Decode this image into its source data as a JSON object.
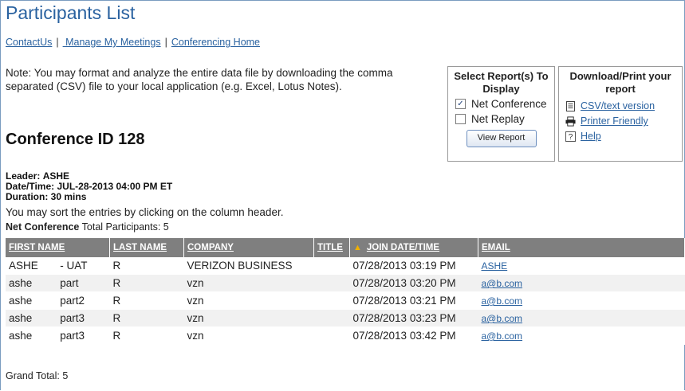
{
  "page": {
    "title": "Participants List"
  },
  "nav": {
    "contact": "ContactUs",
    "meetings": " Manage My Meetings",
    "home": "Conferencing Home",
    "separator": "|"
  },
  "note": "Note: You may format and analyze the entire data file by downloading the comma separated (CSV) file to your local application (e.g. Excel, Lotus Notes).",
  "conference": {
    "heading": "Conference ID 128",
    "leader_label": "Leader:",
    "leader": "ASHE",
    "datetime_label": "Date/Time:",
    "datetime": "JUL-28-2013 04:00 PM ET",
    "duration_label": "Duration:",
    "duration": "30 mins",
    "sort_note": "You may sort the entries by clicking on the column header.",
    "total_label": "Net Conference",
    "total_text": "Total Participants: 5"
  },
  "report_select": {
    "heading": "Select Report(s) To Display",
    "options": [
      {
        "label": "Net Conference",
        "checked": true
      },
      {
        "label": "Net Replay",
        "checked": false
      }
    ],
    "button": "View Report"
  },
  "download": {
    "heading": "Download/Print your report",
    "links": [
      {
        "label": "CSV/text version",
        "icon": "csv-file-icon"
      },
      {
        "label": "Printer Friendly",
        "icon": "printer-icon"
      },
      {
        "label": "Help",
        "icon": "help-icon"
      }
    ]
  },
  "table": {
    "headers": [
      "FIRST NAME",
      "LAST NAME",
      "COMPANY",
      "TITLE",
      "JOIN DATE/TIME",
      "EMAIL"
    ],
    "sort_indicator": "▲",
    "rows": [
      {
        "first": "ASHE",
        "first_b": "- UAT",
        "last": "R",
        "company": "VERIZON BUSINESS",
        "title": "",
        "join": "07/28/2013 03:19 PM",
        "email": "ASHE"
      },
      {
        "first": "ashe",
        "first_b": "part",
        "last": "R",
        "company": "vzn",
        "title": "",
        "join": "07/28/2013 03:20 PM",
        "email": "a@b.com"
      },
      {
        "first": "ashe",
        "first_b": "part2",
        "last": "R",
        "company": "vzn",
        "title": "",
        "join": "07/28/2013 03:21 PM",
        "email": "a@b.com"
      },
      {
        "first": "ashe",
        "first_b": "part3",
        "last": "R",
        "company": "vzn",
        "title": "",
        "join": "07/28/2013 03:23 PM",
        "email": "a@b.com"
      },
      {
        "first": "ashe",
        "first_b": "part3",
        "last": "R",
        "company": "vzn",
        "title": "",
        "join": "07/28/2013 03:42 PM",
        "email": "a@b.com"
      }
    ]
  },
  "grand_total": "Grand Total: 5",
  "colors": {
    "title_blue": "#2a62a0",
    "header_gray": "#7f7f7f",
    "sort_arrow": "#f0b000"
  }
}
